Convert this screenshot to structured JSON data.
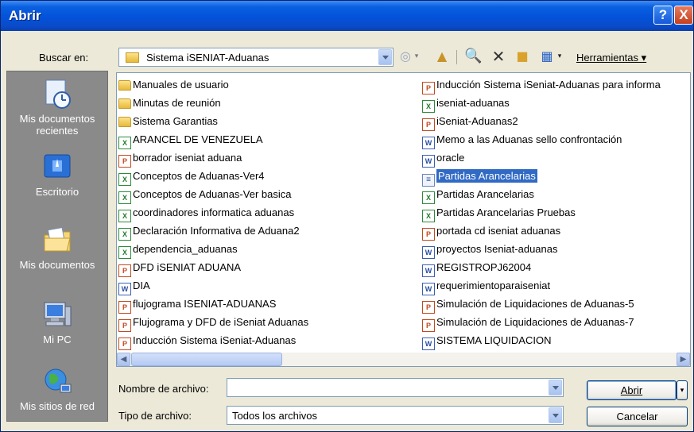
{
  "window": {
    "title": "Abrir",
    "help": "?",
    "close": "X"
  },
  "toolbar": {
    "lookin_label": "Buscar en:",
    "lookin_value": "Sistema iSENIAT-Aduanas",
    "tools_label": "Herramientas"
  },
  "places": [
    {
      "label": "Mis documentos recientes",
      "icon": "recent-documents-icon"
    },
    {
      "label": "Escritorio",
      "icon": "desktop-icon"
    },
    {
      "label": "Mis documentos",
      "icon": "my-documents-icon"
    },
    {
      "label": "Mi PC",
      "icon": "my-computer-icon"
    },
    {
      "label": "Mis sitios de red",
      "icon": "network-places-icon"
    }
  ],
  "files_col1": [
    {
      "name": "Manuales de usuario",
      "type": "folder"
    },
    {
      "name": "Minutas de reunión",
      "type": "folder"
    },
    {
      "name": "Sistema Garantias",
      "type": "folder"
    },
    {
      "name": "ARANCEL DE VENEZUELA",
      "type": "xls"
    },
    {
      "name": "borrador iseniat aduana",
      "type": "ppt"
    },
    {
      "name": "Conceptos de Aduanas-Ver4",
      "type": "xls"
    },
    {
      "name": "Conceptos de Aduanas-Ver basica",
      "type": "xls"
    },
    {
      "name": "coordinadores informatica aduanas",
      "type": "xls"
    },
    {
      "name": "Declaración Informativa de Aduana2",
      "type": "xls"
    },
    {
      "name": "dependencia_aduanas",
      "type": "xls"
    },
    {
      "name": "DFD iSENIAT ADUANA",
      "type": "ppt"
    },
    {
      "name": "DIA",
      "type": "doc"
    },
    {
      "name": "flujograma ISENIAT-ADUANAS",
      "type": "ppt"
    },
    {
      "name": "Flujograma y DFD de iSeniat Aduanas",
      "type": "ppt"
    },
    {
      "name": "Inducción Sistema iSeniat-Aduanas",
      "type": "ppt"
    }
  ],
  "files_col2": [
    {
      "name": "Inducción Sistema iSeniat-Aduanas para informa",
      "type": "ppt"
    },
    {
      "name": "iseniat-aduanas",
      "type": "xls"
    },
    {
      "name": "iSeniat-Aduanas2",
      "type": "ppt"
    },
    {
      "name": "Memo a las Aduanas sello confrontación",
      "type": "doc"
    },
    {
      "name": "oracle",
      "type": "doc"
    },
    {
      "name": "Partidas Arancelarias",
      "type": "txt",
      "selected": true
    },
    {
      "name": "Partidas Arancelarias",
      "type": "xls"
    },
    {
      "name": "Partidas Arancelarias Pruebas",
      "type": "xls"
    },
    {
      "name": "portada cd iseniat aduanas",
      "type": "ppt"
    },
    {
      "name": "proyectos Iseniat-aduanas",
      "type": "doc"
    },
    {
      "name": "REGISTROPJ62004",
      "type": "doc"
    },
    {
      "name": "requerimientoparaiseniat",
      "type": "doc"
    },
    {
      "name": "Simulación de Liquidaciones de Aduanas-5",
      "type": "ppt"
    },
    {
      "name": "Simulación de Liquidaciones de Aduanas-7",
      "type": "ppt"
    },
    {
      "name": "SISTEMA LIQUIDACION",
      "type": "doc"
    }
  ],
  "bottom": {
    "filename_label": "Nombre de archivo:",
    "filename_value": "",
    "filetype_label": "Tipo de archivo:",
    "filetype_value": "Todos los archivos",
    "open_label": "Abrir",
    "cancel_label": "Cancelar"
  }
}
